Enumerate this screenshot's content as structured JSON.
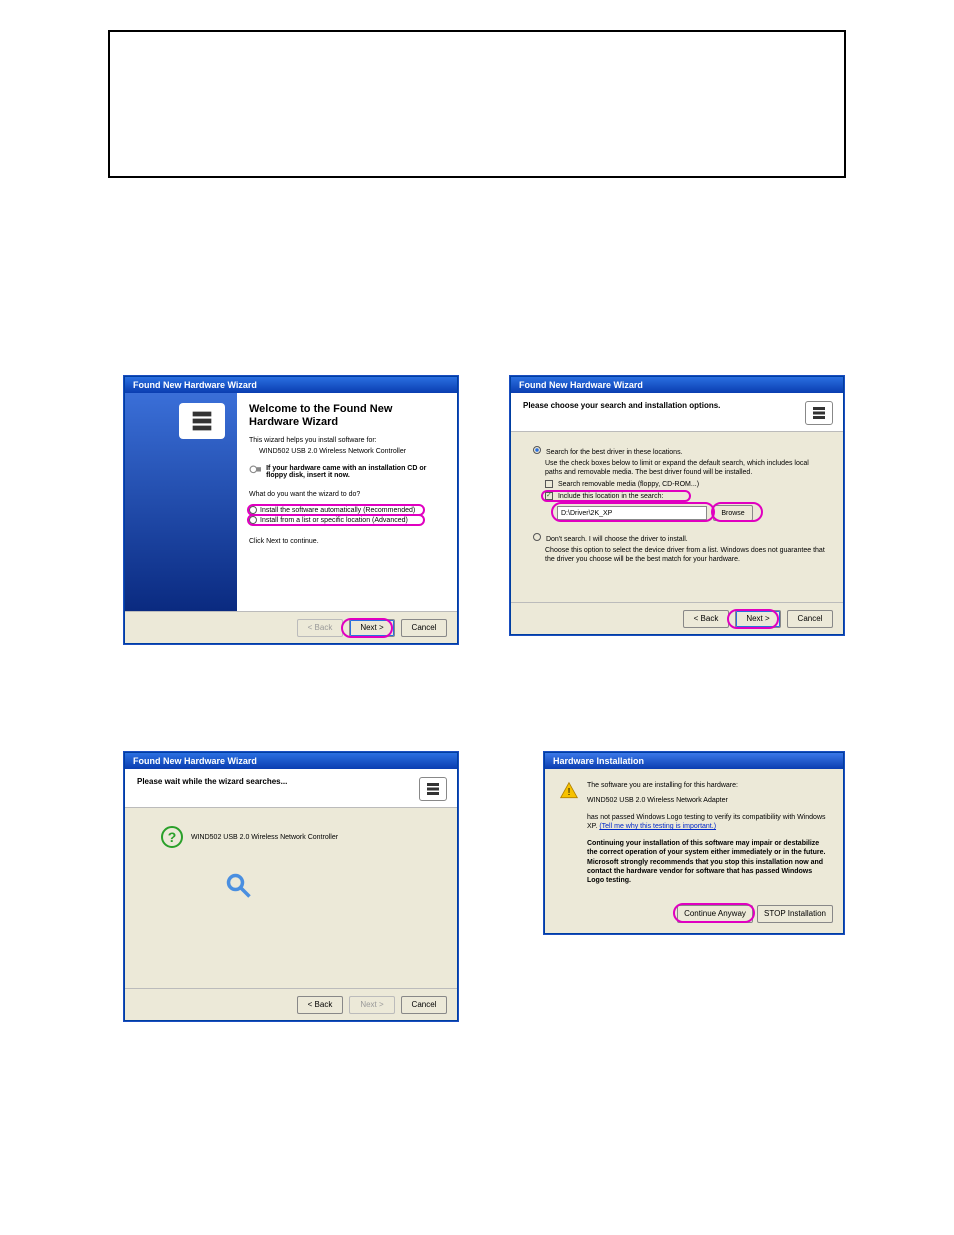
{
  "dialogs": {
    "welcome": {
      "title": "Found New Hardware Wizard",
      "heading": "Welcome to the Found New Hardware Wizard",
      "helps": "This wizard helps you install software for:",
      "device": "WIND502 USB 2.0 Wireless Network Controller",
      "cd_hint": "If your hardware came with an installation CD or floppy disk, insert it now.",
      "question": "What do you want the wizard to do?",
      "radio1": "Install the software automatically (Recommended)",
      "radio2": "Install from a list or specific location (Advanced)",
      "continue": "Click Next to continue.",
      "btn_back": "< Back",
      "btn_next": "Next >",
      "btn_cancel": "Cancel"
    },
    "choose": {
      "title": "Found New Hardware Wizard",
      "heading": "Please choose your search and installation options.",
      "opt_search": "Search for the best driver in these locations.",
      "search_text": "Use the check boxes below to limit or expand the default search, which includes local paths and removable media. The best driver found will be installed.",
      "chk_media": "Search removable media (floppy, CD-ROM...)",
      "chk_include": "Include this location in the search:",
      "path_value": "D:\\Driver\\2K_XP",
      "btn_browse": "Browse",
      "opt_dont": "Don't search. I will choose the driver to install.",
      "dont_text": "Choose this option to select the device driver from a list. Windows does not guarantee that the driver you choose will be the best match for your hardware.",
      "btn_back": "< Back",
      "btn_next": "Next >",
      "btn_cancel": "Cancel"
    },
    "searching": {
      "title": "Found New Hardware Wizard",
      "heading": "Please wait while the wizard searches...",
      "device": "WIND502 USB 2.0 Wireless Network Controller",
      "btn_back": "< Back",
      "btn_next": "Next >",
      "btn_cancel": "Cancel"
    },
    "hi": {
      "title": "Hardware Installation",
      "line1": "The software you are installing for this hardware:",
      "device": "WIND502 USB 2.0 Wireless Network Adapter",
      "line2a": "has not passed Windows Logo testing to verify its compatibility with Windows XP. ",
      "link": "(Tell me why this testing is important.)",
      "bold": "Continuing your installation of this software may impair or destabilize the correct operation of your system either immediately or in the future. Microsoft strongly recommends that you stop this installation now and contact the hardware vendor for software that has passed Windows Logo testing.",
      "btn_continue": "Continue Anyway",
      "btn_stop": "STOP Installation"
    }
  }
}
